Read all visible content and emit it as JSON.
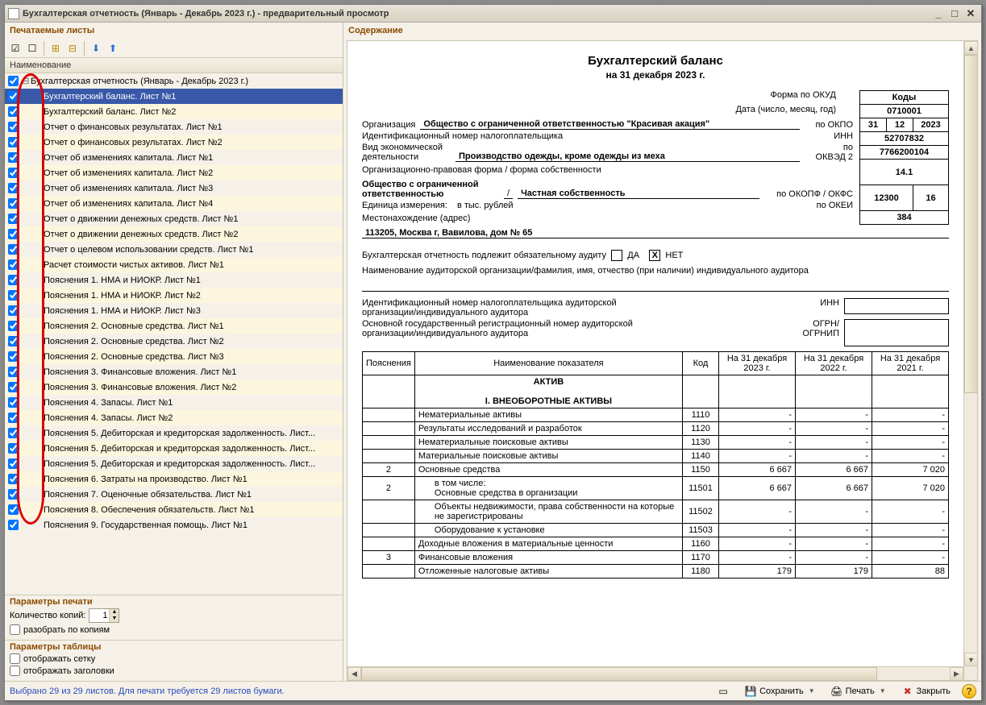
{
  "window": {
    "title": "Бухгалтерская отчетность (Январь - Декабрь 2023 г.) - предварительный просмотр"
  },
  "left": {
    "panel_title": "Печатаемые листы",
    "header": "Наименование",
    "root": "Бухгалтерская отчетность (Январь - Декабрь 2023 г.)",
    "items": [
      "Бухгалтерский баланс. Лист №1",
      "Бухгалтерский баланс. Лист №2",
      "Отчет о финансовых результатах. Лист №1",
      "Отчет о финансовых результатах. Лист №2",
      "Отчет об изменениях капитала. Лист №1",
      "Отчет об изменениях капитала. Лист №2",
      "Отчет об изменениях капитала. Лист №3",
      "Отчет об изменениях капитала. Лист №4",
      "Отчет о движении денежных средств. Лист №1",
      "Отчет о движении денежных средств. Лист №2",
      "Отчет о целевом использовании средств. Лист №1",
      "Расчет стоимости чистых активов. Лист №1",
      "Пояснения 1. НМА и НИОКР. Лист №1",
      "Пояснения 1. НМА и НИОКР. Лист №2",
      "Пояснения 1. НМА и НИОКР. Лист №3",
      "Пояснения 2. Основные средства. Лист №1",
      "Пояснения 2. Основные средства. Лист №2",
      "Пояснения 2. Основные средства. Лист №3",
      "Пояснения 3. Финансовые вложения. Лист №1",
      "Пояснения 3. Финансовые вложения. Лист №2",
      "Пояснения 4. Запасы. Лист №1",
      "Пояснения 4. Запасы. Лист №2",
      "Пояснения 5. Дебиторская и кредиторская задолженность. Лист...",
      "Пояснения 5. Дебиторская и кредиторская задолженность. Лист...",
      "Пояснения 5. Дебиторская и кредиторская задолженность. Лист...",
      "Пояснения 6. Затраты на производство. Лист №1",
      "Пояснения 7. Оценочные обязательства. Лист №1",
      "Пояснения 8. Обеспечения обязательств. Лист №1",
      "Пояснения 9. Государственная помощь. Лист №1"
    ],
    "selected_index": 0
  },
  "print_params": {
    "title": "Параметры печати",
    "copies_label": "Количество копий:",
    "copies": "1",
    "split_label": "разобрать по копиям"
  },
  "table_params": {
    "title": "Параметры таблицы",
    "grid_label": "отображать сетку",
    "headers_label": "отображать заголовки"
  },
  "preview_title": "Содержание",
  "doc": {
    "title": "Бухгалтерский баланс",
    "subtitle": "на 31 декабря 2023 г.",
    "codes_header": "Коды",
    "form_okud_label": "Форма по ОКУД",
    "form_okud": "0710001",
    "date_label": "Дата (число, месяц, год)",
    "date_d": "31",
    "date_m": "12",
    "date_y": "2023",
    "org_label": "Организация",
    "org_name": "Общество с ограниченной ответственностью \"Красивая акация\"",
    "okpo_label": "по ОКПО",
    "okpo": "52707832",
    "inn_label": "Идентификационный номер налогоплательщика",
    "inn_rt": "ИНН",
    "inn": "7766200104",
    "activity_label1": "Вид экономической",
    "activity_label2": "деятельности",
    "activity": "Производство одежды, кроме одежды из меха",
    "okved_label": "по\nОКВЭД 2",
    "okved": "14.1",
    "legal_form_label": "Организационно-правовая форма / форма собственности",
    "legal_form1": "Общество с ограниченной",
    "legal_form2": "ответственностью",
    "legal_form_sep": "/",
    "ownership": "Частная собственность",
    "okopf_label": "по ОКОПФ / ОКФС",
    "okopf": "12300",
    "okfs": "16",
    "unit_label": "Единица измерения:",
    "unit": "в тыс. рублей",
    "okei_label": "по ОКЕИ",
    "okei": "384",
    "address_label": "Местонахождение (адрес)",
    "address": "113205, Москва г, Вавилова, дом № 65",
    "audit_line": "Бухгалтерская отчетность подлежит обязательному аудиту",
    "audit_yes": "ДА",
    "audit_no": "НЕТ",
    "audit_mark": "X",
    "auditor_name_label": "Наименование аудиторской организации/фамилия, имя, отчество (при наличии) индивидуального аудитора",
    "auditor_inn_label1": "Идентификационный номер налогоплательщика аудиторской",
    "auditor_inn_label2": "организации/индивидуального аудитора",
    "auditor_inn_rt": "ИНН",
    "auditor_ogrn_label1": "Основной государственный регистрационный номер аудиторской",
    "auditor_ogrn_label2": "организации/индивидуального аудитора",
    "auditor_ogrn_rt": "ОГРН/\nОГРНИП",
    "table": {
      "h1": "Пояснения",
      "h2": "Наименование показателя",
      "h3": "Код",
      "h4": "На 31 декабря 2023 г.",
      "h5": "На 31 декабря 2022 г.",
      "h6": "На 31 декабря 2021 г.",
      "section1": "АКТИВ",
      "section2": "I. ВНЕОБОРОТНЫЕ АКТИВЫ",
      "rows": [
        {
          "p": "",
          "name": "Нематериальные активы",
          "code": "1110",
          "v1": "-",
          "v2": "-",
          "v3": "-"
        },
        {
          "p": "",
          "name": "Результаты исследований и разработок",
          "code": "1120",
          "v1": "-",
          "v2": "-",
          "v3": "-"
        },
        {
          "p": "",
          "name": "Нематериальные поисковые активы",
          "code": "1130",
          "v1": "-",
          "v2": "-",
          "v3": "-"
        },
        {
          "p": "",
          "name": "Материальные поисковые активы",
          "code": "1140",
          "v1": "-",
          "v2": "-",
          "v3": "-"
        },
        {
          "p": "2",
          "name": "Основные средства",
          "code": "1150",
          "v1": "6 667",
          "v2": "6 667",
          "v3": "7 020"
        },
        {
          "p": "2",
          "name": "в том числе:\nОсновные средства в организации",
          "code": "11501",
          "v1": "6 667",
          "v2": "6 667",
          "v3": "7 020"
        },
        {
          "p": "",
          "name": "Объекты недвижимости, права собственности на которые не зарегистрированы",
          "code": "11502",
          "v1": "-",
          "v2": "-",
          "v3": "-"
        },
        {
          "p": "",
          "name": "Оборудование к установке",
          "code": "11503",
          "v1": "-",
          "v2": "-",
          "v3": "-"
        },
        {
          "p": "",
          "name": "Доходные вложения в материальные ценности",
          "code": "1160",
          "v1": "-",
          "v2": "-",
          "v3": "-"
        },
        {
          "p": "3",
          "name": "Финансовые вложения",
          "code": "1170",
          "v1": "-",
          "v2": "-",
          "v3": "-"
        },
        {
          "p": "",
          "name": "Отложенные налоговые активы",
          "code": "1180",
          "v1": "179",
          "v2": "179",
          "v3": "88"
        }
      ]
    }
  },
  "status": {
    "text": "Выбрано 29 из 29 листов. Для печати требуется 29 листов бумаги.",
    "save": "Сохранить",
    "print": "Печать",
    "close": "Закрыть"
  }
}
